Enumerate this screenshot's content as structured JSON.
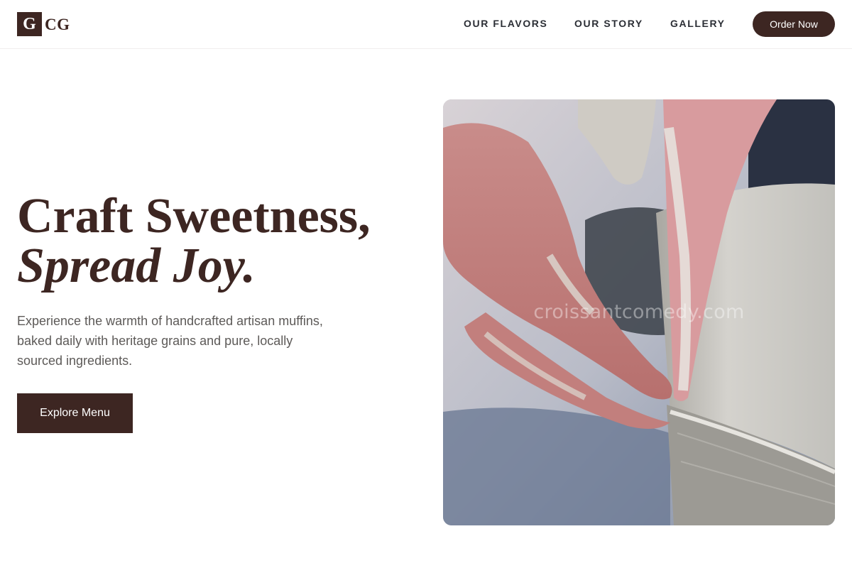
{
  "nav": {
    "logo_mark": "G",
    "logo_text": "CG",
    "links": [
      "OUR FLAVORS",
      "OUR STORY",
      "GALLERY"
    ],
    "order_label": "Order Now"
  },
  "hero": {
    "title_line1": "Craft Sweetness,",
    "title_line2": "Spread Joy.",
    "description": "Experience the warmth of handcrafted artisan muffins, baked daily with heritage grains and pure, locally sourced ingredients.",
    "cta_label": "Explore Menu",
    "image_watermark": "croissantcomedy.com"
  },
  "colors": {
    "brand": "#3d2622",
    "nav_text": "#2b2e35",
    "body_text": "#5d5a58"
  }
}
